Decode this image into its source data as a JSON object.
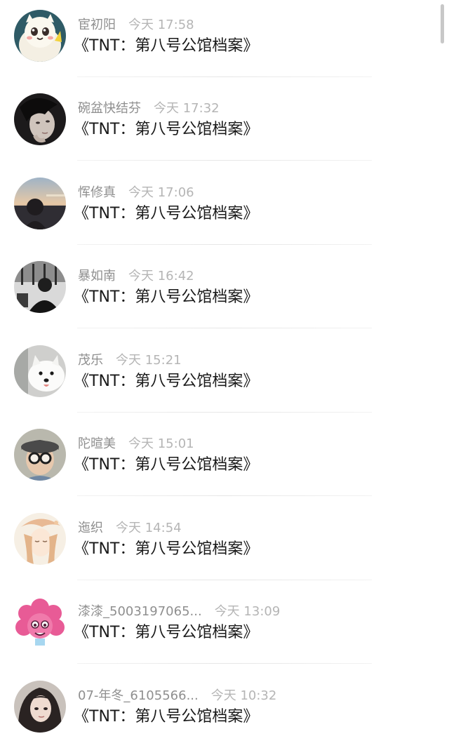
{
  "comments": [
    {
      "username": "宦初阳",
      "time": "今天 17:58",
      "content": "《TNT：第八号公馆档案》",
      "avatar_icon": "cartoon-cat-avatar-icon"
    },
    {
      "username": "碗盆快结芬",
      "time": "今天 17:32",
      "content": "《TNT：第八号公馆档案》",
      "avatar_icon": "portrait-dark-hair-avatar-icon"
    },
    {
      "username": "恽修真",
      "time": "今天 17:06",
      "content": "《TNT：第八号公馆档案》",
      "avatar_icon": "sunset-portrait-avatar-icon"
    },
    {
      "username": "暴如南",
      "time": "今天 16:42",
      "content": "《TNT：第八号公馆档案》",
      "avatar_icon": "black-white-photo-avatar-icon"
    },
    {
      "username": "茂乐",
      "time": "今天 15:21",
      "content": "《TNT：第八号公馆档案》",
      "avatar_icon": "white-dog-avatar-icon"
    },
    {
      "username": "陀暄美",
      "time": "今天 15:01",
      "content": "《TNT：第八号公馆档案》",
      "avatar_icon": "child-with-glasses-avatar-icon"
    },
    {
      "username": "迤织",
      "time": "今天 14:54",
      "content": "《TNT：第八号公馆档案》",
      "avatar_icon": "anime-illustration-avatar-icon"
    },
    {
      "username": "漆漆_5003197065...",
      "time": "今天 13:09",
      "content": "《TNT：第八号公馆档案》",
      "avatar_icon": "pink-cartoon-avatar-icon"
    },
    {
      "username": "07-年冬_6105566...",
      "time": "今天 10:32",
      "content": "《TNT：第八号公馆档案》",
      "avatar_icon": "girl-portrait-avatar-icon"
    }
  ],
  "colors": {
    "username": "#8f8f8f",
    "time": "#b5b5b5",
    "content": "#1a1a1a",
    "divider": "#ececec"
  }
}
